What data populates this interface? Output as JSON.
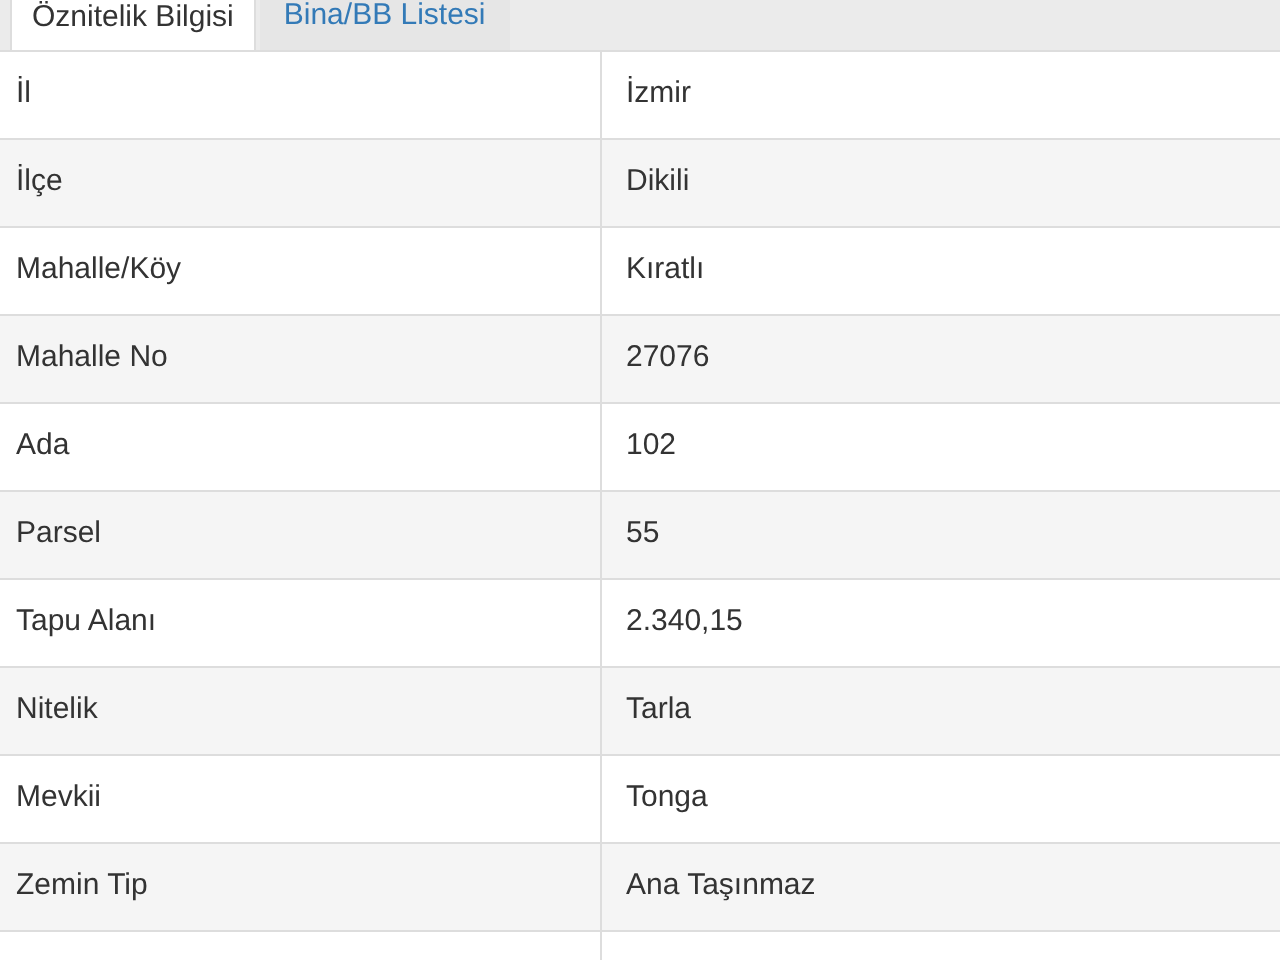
{
  "tabs": [
    {
      "label": "Öznitelik Bilgisi",
      "selected": true
    },
    {
      "label": "Bina/BB Listesi",
      "selected": false
    }
  ],
  "table": {
    "rows": [
      {
        "label": "İl",
        "value": "İzmir"
      },
      {
        "label": "İlçe",
        "value": "Dikili"
      },
      {
        "label": "Mahalle/Köy",
        "value": "Kıratlı"
      },
      {
        "label": "Mahalle No",
        "value": "27076"
      },
      {
        "label": "Ada",
        "value": "102"
      },
      {
        "label": "Parsel",
        "value": "55"
      },
      {
        "label": "Tapu Alanı",
        "value": "2.340,15"
      },
      {
        "label": "Nitelik",
        "value": "Tarla"
      },
      {
        "label": "Mevkii",
        "value": "Tonga"
      },
      {
        "label": "Zemin Tip",
        "value": "Ana Taşınmaz"
      }
    ]
  }
}
